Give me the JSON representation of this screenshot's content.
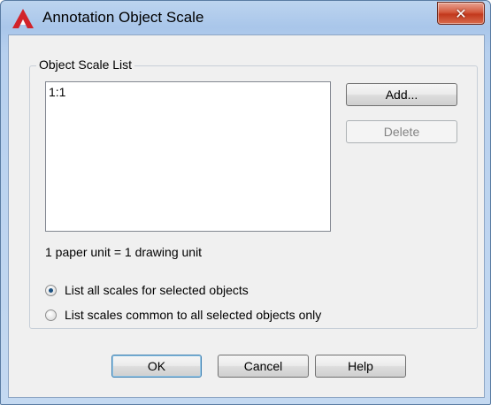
{
  "window": {
    "title": "Annotation Object Scale",
    "app_icon": "autocad-a-icon",
    "close_label": "✕"
  },
  "group": {
    "legend": "Object Scale List",
    "scales": [
      "1:1"
    ],
    "unit_text": "1 paper unit = 1 drawing unit"
  },
  "buttons": {
    "add": "Add...",
    "delete": "Delete",
    "ok": "OK",
    "cancel": "Cancel",
    "help": "Help"
  },
  "radios": [
    {
      "label": "List all scales for selected objects",
      "checked": true
    },
    {
      "label": "List scales common to all selected objects only",
      "checked": false
    }
  ],
  "colors": {
    "title_gradient": "#a9c6ea",
    "close_button": "#c2381c",
    "icon_red": "#d2232a"
  }
}
